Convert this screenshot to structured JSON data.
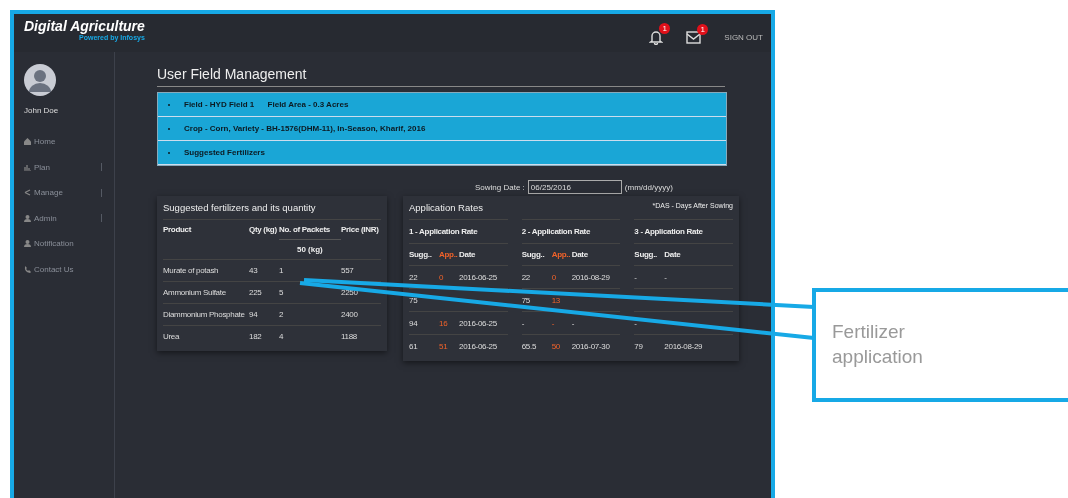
{
  "header": {
    "title": "Digital Agriculture",
    "subtitle": "Powered by Infosys",
    "notifications": [
      {
        "kind": "bell",
        "count": "1"
      },
      {
        "kind": "mail",
        "count": "1"
      }
    ],
    "sign_out": "SIGN OUT"
  },
  "user": {
    "name": "John Doe"
  },
  "sidebar": {
    "items": [
      {
        "label": "Home",
        "expandable": false
      },
      {
        "label": "Plan",
        "expandable": true
      },
      {
        "label": "Manage",
        "expandable": true
      },
      {
        "label": "Admin",
        "expandable": true
      },
      {
        "label": "Notification",
        "expandable": false
      },
      {
        "label": "Contact Us",
        "expandable": false
      }
    ]
  },
  "page_title": "User Field Management",
  "accordion": [
    "Field - HYD Field 1      Field Area - 0.3 Acres",
    "Crop - Corn, Variety - BH-1576(DHM-11), In-Season, Kharif, 2016",
    "Suggested Fertilizers"
  ],
  "sowing": {
    "label": "Sowing Date :",
    "value": "06/25/2016",
    "hint": "(mm/dd/yyyy)"
  },
  "fertilizers": {
    "title": "Suggested fertilizers and its quantity",
    "columns": [
      "Product",
      "Qty (kg)",
      "No. of Packets",
      "Price (INR)"
    ],
    "subheader": "50 (kg)",
    "rows": [
      [
        "Murate of potash",
        "43",
        "1",
        "557"
      ],
      [
        "Ammonium Sulfate",
        "225",
        "5",
        "2250"
      ],
      [
        "Diammonium Phosphate",
        "94",
        "2",
        "2400"
      ],
      [
        "Urea",
        "182",
        "4",
        "1188"
      ]
    ]
  },
  "rates": {
    "title": "Application Rates",
    "note": "*DAS - Days After Sowing",
    "sets": [
      {
        "title": "1 - Application Rate",
        "columns": [
          {
            "label": "Sugg..",
            "kind": "sugg"
          },
          {
            "label": "App..",
            "kind": "app"
          },
          {
            "label": "Date",
            "kind": "date"
          }
        ],
        "rows": [
          [
            "22",
            "0",
            "2016-06-25"
          ],
          [
            "75",
            null,
            null
          ],
          [
            "94",
            "16",
            "2016-06-25"
          ],
          [
            "61",
            "51",
            "2016-06-25"
          ]
        ]
      },
      {
        "title": "2 - Application Rate",
        "columns": [
          {
            "label": "Sugg..",
            "kind": "sugg"
          },
          {
            "label": "App..",
            "kind": "app"
          },
          {
            "label": "Date",
            "kind": "date"
          }
        ],
        "rows": [
          [
            "22",
            "0",
            "2016-08-29"
          ],
          [
            "75",
            "13",
            null
          ],
          [
            "-",
            "-",
            "-"
          ],
          [
            "65.5",
            "50",
            "2016-07-30"
          ]
        ]
      },
      {
        "title": "3 - Application Rate",
        "columns": [
          {
            "label": "Sugg..",
            "kind": "sugg"
          },
          {
            "label": "Date",
            "kind": "date"
          }
        ],
        "rows": [
          [
            "-",
            "-"
          ],
          [
            null,
            null
          ],
          [
            "-",
            null
          ],
          [
            "79",
            "2016-08-29"
          ]
        ]
      }
    ]
  },
  "callout": {
    "text": "Fertilizer application"
  }
}
